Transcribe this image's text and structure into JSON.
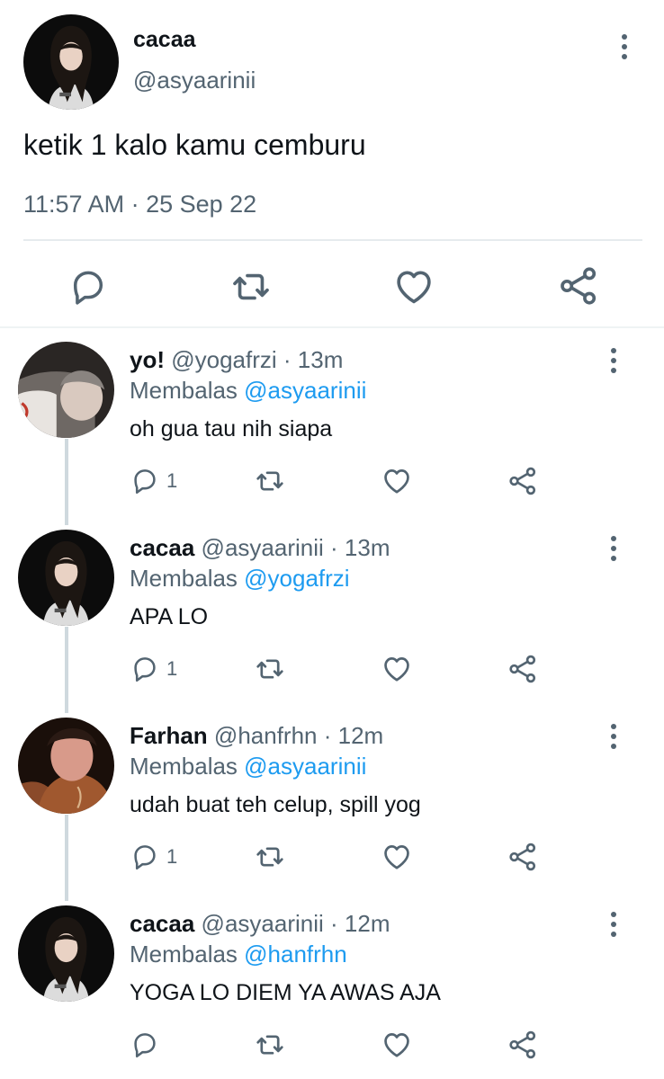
{
  "main_tweet": {
    "name": "cacaa",
    "handle": "@asyaarinii",
    "text": "ketik 1 kalo kamu cemburu",
    "timestamp": "11:57 AM · 25 Sep 22"
  },
  "replies": [
    {
      "name": "yo!",
      "handle": "@yogafrzi",
      "time": "· 13m",
      "reply_prefix": "Membalas ",
      "reply_to": "@asyaarinii",
      "text": "oh gua tau nih siapa",
      "reply_count": "1"
    },
    {
      "name": "cacaa",
      "handle": "@asyaarinii",
      "time": "· 13m",
      "reply_prefix": "Membalas ",
      "reply_to": "@yogafrzi",
      "text": "APA LO",
      "reply_count": "1"
    },
    {
      "name": "Farhan",
      "handle": "@hanfrhn",
      "time": "· 12m",
      "reply_prefix": "Membalas ",
      "reply_to": "@asyaarinii",
      "text": "udah buat teh celup, spill yog",
      "reply_count": "1"
    },
    {
      "name": "cacaa",
      "handle": "@asyaarinii",
      "time": "· 12m",
      "reply_prefix": "Membalas ",
      "reply_to": "@hanfrhn",
      "text": "YOGA LO DIEM YA AWAS AJA",
      "reply_count": ""
    }
  ],
  "icons": {
    "reply": "reply-bubble-icon",
    "retweet": "retweet-icon",
    "like": "heart-icon",
    "share": "share-icon",
    "more": "more-vertical-icon"
  },
  "colors": {
    "text_primary": "#0f1419",
    "text_secondary": "#536471",
    "mention": "#1d9bf0",
    "thread_line": "#cfd9de"
  }
}
